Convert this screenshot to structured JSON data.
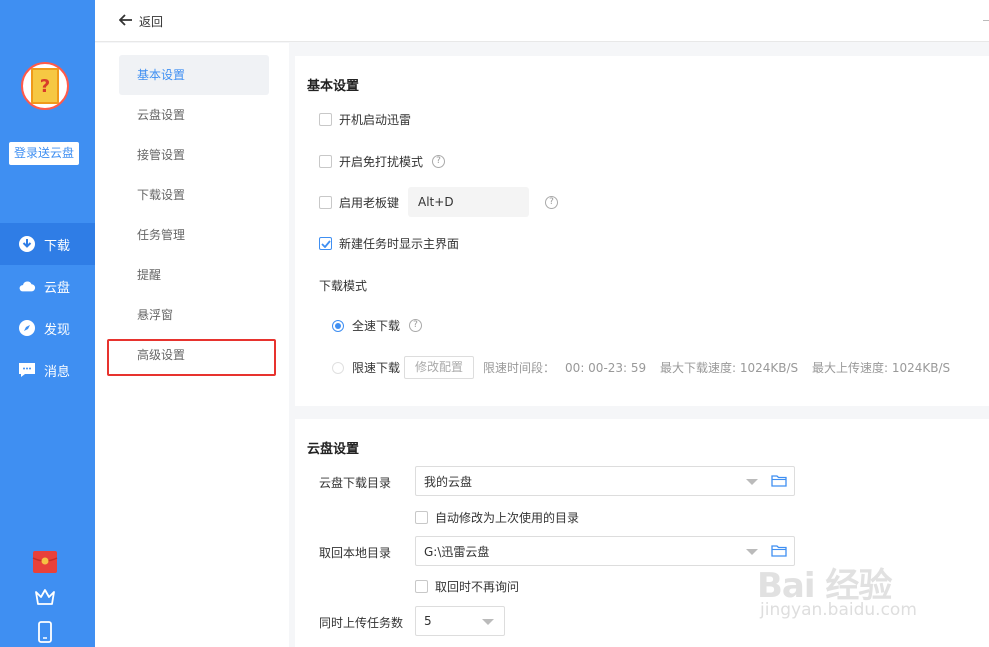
{
  "sidebar": {
    "login_button": "登录送云盘",
    "items": [
      {
        "label": "下载",
        "icon": "download-icon",
        "active": true
      },
      {
        "label": "云盘",
        "icon": "cloud-icon",
        "active": false
      },
      {
        "label": "发现",
        "icon": "compass-icon",
        "active": false
      },
      {
        "label": "消息",
        "icon": "message-icon",
        "active": false
      }
    ],
    "bottom_icons": [
      "red-envelope-icon",
      "crown-icon",
      "phone-icon"
    ]
  },
  "topbar": {
    "back_label": "返回"
  },
  "menu": {
    "items": [
      {
        "label": "基本设置",
        "active": true
      },
      {
        "label": "云盘设置",
        "active": false
      },
      {
        "label": "接管设置",
        "active": false
      },
      {
        "label": "下载设置",
        "active": false
      },
      {
        "label": "任务管理",
        "active": false
      },
      {
        "label": "提醒",
        "active": false
      },
      {
        "label": "悬浮窗",
        "active": false
      },
      {
        "label": "高级设置",
        "active": false,
        "highlighted": true
      }
    ]
  },
  "basic": {
    "title": "基本设置",
    "autostart": {
      "label": "开机启动迅雷",
      "checked": false
    },
    "nodisturb": {
      "label": "开启免打扰模式",
      "checked": false
    },
    "bosskey": {
      "label": "启用老板键",
      "checked": false,
      "hotkey": "Alt+D"
    },
    "showmain": {
      "label": "新建任务时显示主界面",
      "checked": true
    },
    "download_mode": {
      "label": "下载模式",
      "full_speed": {
        "label": "全速下载",
        "selected": true
      },
      "limited": {
        "label": "限速下载",
        "selected": false,
        "button": "修改配置",
        "period_label": "限速时间段：",
        "period_value": "00: 00-23: 59",
        "max_download": "最大下载速度: 1024KB/S",
        "max_upload": "最大上传速度: 1024KB/S"
      }
    }
  },
  "cloud": {
    "title": "云盘设置",
    "download_dir": {
      "label": "云盘下载目录",
      "value": "我的云盘"
    },
    "auto_modify": {
      "label": "自动修改为上次使用的目录",
      "checked": false
    },
    "local_dir": {
      "label": "取回本地目录",
      "value": "G:\\迅雷云盘"
    },
    "no_ask": {
      "label": "取回时不再询问",
      "checked": false
    },
    "concurrent": {
      "label": "同时上传任务数",
      "value": "5"
    }
  },
  "watermark": {
    "brand": "Bai 经验",
    "url": "jingyan.baidu.com"
  },
  "colors": {
    "sidebar": "#3f8ff2",
    "accent": "#3f8ff2",
    "highlight": "#e7332e"
  }
}
